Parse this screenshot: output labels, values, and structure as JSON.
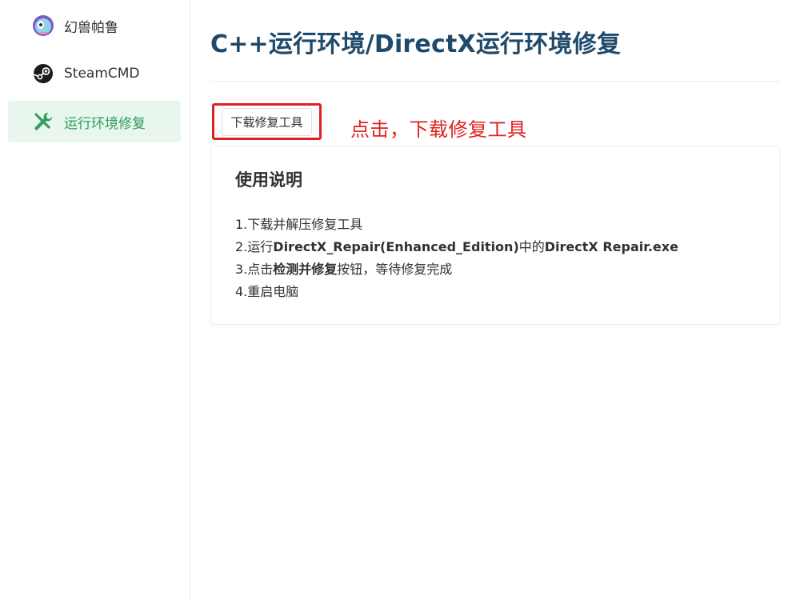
{
  "sidebar": {
    "items": [
      {
        "label": "幻兽帕鲁",
        "icon": "palworld-logo-icon",
        "active": false
      },
      {
        "label": "SteamCMD",
        "icon": "steam-icon",
        "active": false
      },
      {
        "label": "运行环境修复",
        "icon": "tools-icon",
        "active": true
      }
    ]
  },
  "main": {
    "title": "C++运行环境/DirectX运行环境修复",
    "download_button": "下载修复工具",
    "annotation": "点击，下载修复工具",
    "card": {
      "title": "使用说明",
      "steps": [
        {
          "parts": [
            {
              "t": "1.下载并解压修复工具",
              "b": false
            }
          ]
        },
        {
          "parts": [
            {
              "t": "2.运行",
              "b": false
            },
            {
              "t": "DirectX_Repair(Enhanced_Edition)",
              "b": true
            },
            {
              "t": "中的",
              "b": false
            },
            {
              "t": "DirectX Repair.exe",
              "b": true
            }
          ]
        },
        {
          "parts": [
            {
              "t": "3.点击",
              "b": false
            },
            {
              "t": "检测并修复",
              "b": true
            },
            {
              "t": "按钮，等待修复完成",
              "b": false
            }
          ]
        },
        {
          "parts": [
            {
              "t": "4.重启电脑",
              "b": false
            }
          ]
        }
      ]
    }
  },
  "colors": {
    "accent": "#2e9e5b",
    "active_bg": "#e8f6ee",
    "title": "#1f4a6b",
    "annotation_red": "#e02020"
  }
}
